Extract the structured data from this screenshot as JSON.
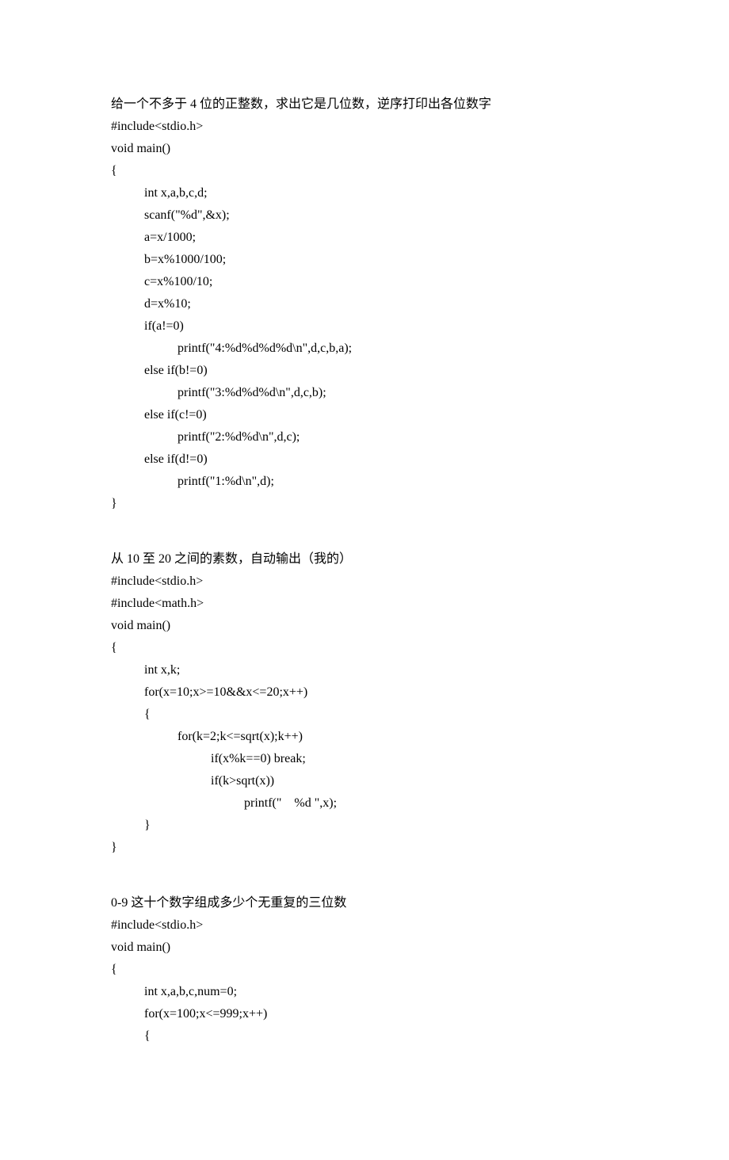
{
  "block1": {
    "title": "给一个不多于 4 位的正整数，求出它是几位数，逆序打印出各位数字",
    "lines": [
      {
        "i": 0,
        "t": "#include<stdio.h>"
      },
      {
        "i": 0,
        "t": "void main()"
      },
      {
        "i": 0,
        "t": "{"
      },
      {
        "i": 1,
        "t": "int x,a,b,c,d;"
      },
      {
        "i": 1,
        "t": "scanf(\"%d\",&x);"
      },
      {
        "i": 1,
        "t": "a=x/1000;"
      },
      {
        "i": 1,
        "t": "b=x%1000/100;"
      },
      {
        "i": 1,
        "t": "c=x%100/10;"
      },
      {
        "i": 1,
        "t": "d=x%10;"
      },
      {
        "i": 1,
        "t": "if(a!=0)"
      },
      {
        "i": 2,
        "t": "printf(\"4:%d%d%d%d\\n\",d,c,b,a);"
      },
      {
        "i": 1,
        "t": "else if(b!=0)"
      },
      {
        "i": 2,
        "t": "printf(\"3:%d%d%d\\n\",d,c,b);"
      },
      {
        "i": 1,
        "t": "else if(c!=0)"
      },
      {
        "i": 2,
        "t": "printf(\"2:%d%d\\n\",d,c);"
      },
      {
        "i": 1,
        "t": "else if(d!=0)"
      },
      {
        "i": 2,
        "t": "printf(\"1:%d\\n\",d);"
      },
      {
        "i": 0,
        "t": "}"
      }
    ]
  },
  "block2": {
    "title": "从 10 至 20 之间的素数，自动输出（我的）",
    "lines": [
      {
        "i": 0,
        "t": "#include<stdio.h>"
      },
      {
        "i": 0,
        "t": "#include<math.h>"
      },
      {
        "i": 0,
        "t": "void main()"
      },
      {
        "i": 0,
        "t": "{"
      },
      {
        "i": 1,
        "t": "int x,k;"
      },
      {
        "i": 1,
        "t": "for(x=10;x>=10&&x<=20;x++)"
      },
      {
        "i": 1,
        "t": "{"
      },
      {
        "i": 2,
        "t": "for(k=2;k<=sqrt(x);k++)"
      },
      {
        "i": 3,
        "t": "if(x%k==0) break;"
      },
      {
        "i": 3,
        "t": "if(k>sqrt(x))"
      },
      {
        "i": 4,
        "t": "printf(\"    %d \",x);"
      },
      {
        "i": 1,
        "t": "}"
      },
      {
        "i": 0,
        "t": "}"
      }
    ]
  },
  "block3": {
    "title": "0-9 这十个数字组成多少个无重复的三位数",
    "lines": [
      {
        "i": 0,
        "t": "#include<stdio.h>"
      },
      {
        "i": 0,
        "t": "void main()"
      },
      {
        "i": 0,
        "t": "{"
      },
      {
        "i": 1,
        "t": "int x,a,b,c,num=0;"
      },
      {
        "i": 1,
        "t": "for(x=100;x<=999;x++)"
      },
      {
        "i": 1,
        "t": "{"
      }
    ]
  }
}
